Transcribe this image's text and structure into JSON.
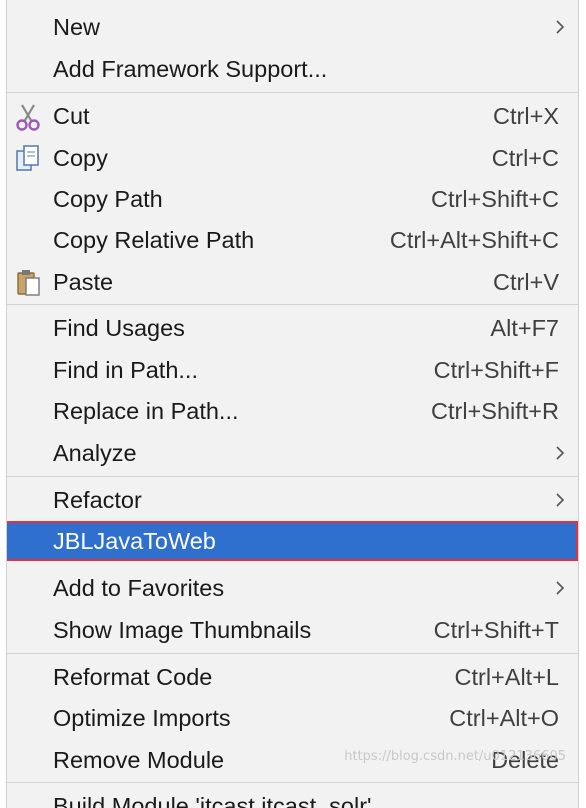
{
  "menu": {
    "items": [
      {
        "label": "New",
        "shortcut": "",
        "submenu": true
      },
      {
        "label": "Add Framework Support...",
        "shortcut": "",
        "submenu": false
      },
      {
        "label": "Cut",
        "shortcut": "Ctrl+X",
        "submenu": false,
        "icon": "scissors-icon"
      },
      {
        "label": "Copy",
        "shortcut": "Ctrl+C",
        "submenu": false,
        "icon": "copy-icon"
      },
      {
        "label": "Copy Path",
        "shortcut": "Ctrl+Shift+C",
        "submenu": false
      },
      {
        "label": "Copy Relative Path",
        "shortcut": "Ctrl+Alt+Shift+C",
        "submenu": false
      },
      {
        "label": "Paste",
        "shortcut": "Ctrl+V",
        "submenu": false,
        "icon": "paste-icon"
      },
      {
        "label": "Find Usages",
        "shortcut": "Alt+F7",
        "submenu": false
      },
      {
        "label": "Find in Path...",
        "shortcut": "Ctrl+Shift+F",
        "submenu": false
      },
      {
        "label": "Replace in Path...",
        "shortcut": "Ctrl+Shift+R",
        "submenu": false
      },
      {
        "label": "Analyze",
        "shortcut": "",
        "submenu": true
      },
      {
        "label": "Refactor",
        "shortcut": "",
        "submenu": true
      },
      {
        "label": "JBLJavaToWeb",
        "shortcut": "",
        "submenu": false,
        "selected": true
      },
      {
        "label": "Add to Favorites",
        "shortcut": "",
        "submenu": true
      },
      {
        "label": "Show Image Thumbnails",
        "shortcut": "Ctrl+Shift+T",
        "submenu": false
      },
      {
        "label": "Reformat Code",
        "shortcut": "Ctrl+Alt+L",
        "submenu": false
      },
      {
        "label": "Optimize Imports",
        "shortcut": "Ctrl+Alt+O",
        "submenu": false
      },
      {
        "label": "Remove Module",
        "shortcut": "Delete",
        "submenu": false
      },
      {
        "label": "Build Module 'itcast itcast_solr'",
        "shortcut": "",
        "submenu": false
      }
    ]
  },
  "colors": {
    "menu_bg": "#f2f2f2",
    "selected_bg": "#2f6fce",
    "selected_border": "#e0343c"
  },
  "watermark": "https://blog.csdn.net/u012136605"
}
